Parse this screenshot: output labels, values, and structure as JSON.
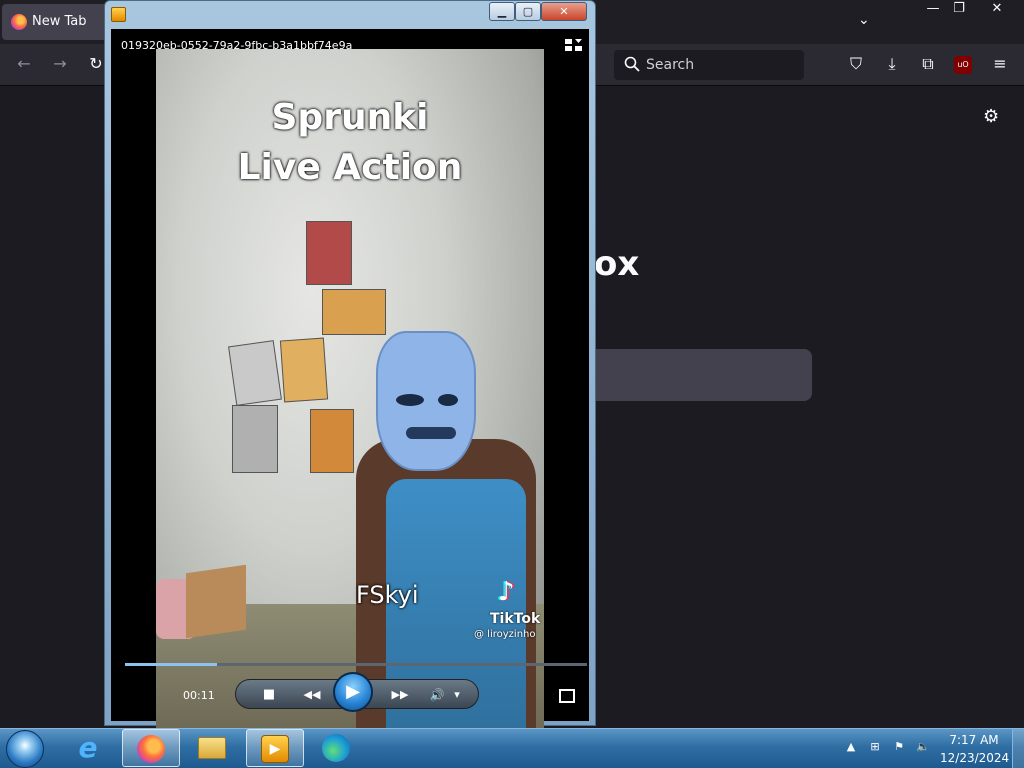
{
  "firefox": {
    "tab_title": "New Tab",
    "search_placeholder": "Search",
    "wordmark_partial": "ox"
  },
  "player": {
    "filename": "019320eb-0552-79a2-9fbc-b3a1bbf74e9a",
    "video": {
      "title_line1": "Sprunki",
      "title_line2": "Live Action",
      "caption": "FSkyi",
      "watermark_brand": "TikTok",
      "watermark_user": "@ liroyzinho"
    },
    "controls": {
      "elapsed": "00:11",
      "progress": 0.2,
      "stop": "■",
      "rewind": "◀◀",
      "play": "▶",
      "forward": "▶▶",
      "volume": "🔊",
      "volume_menu": "▾"
    }
  },
  "taskbar": {
    "items": [
      "start",
      "internet-explorer",
      "firefox",
      "file-explorer",
      "media-player",
      "edge"
    ],
    "clock_time": "7:17 AM",
    "clock_date": "12/23/2024"
  }
}
